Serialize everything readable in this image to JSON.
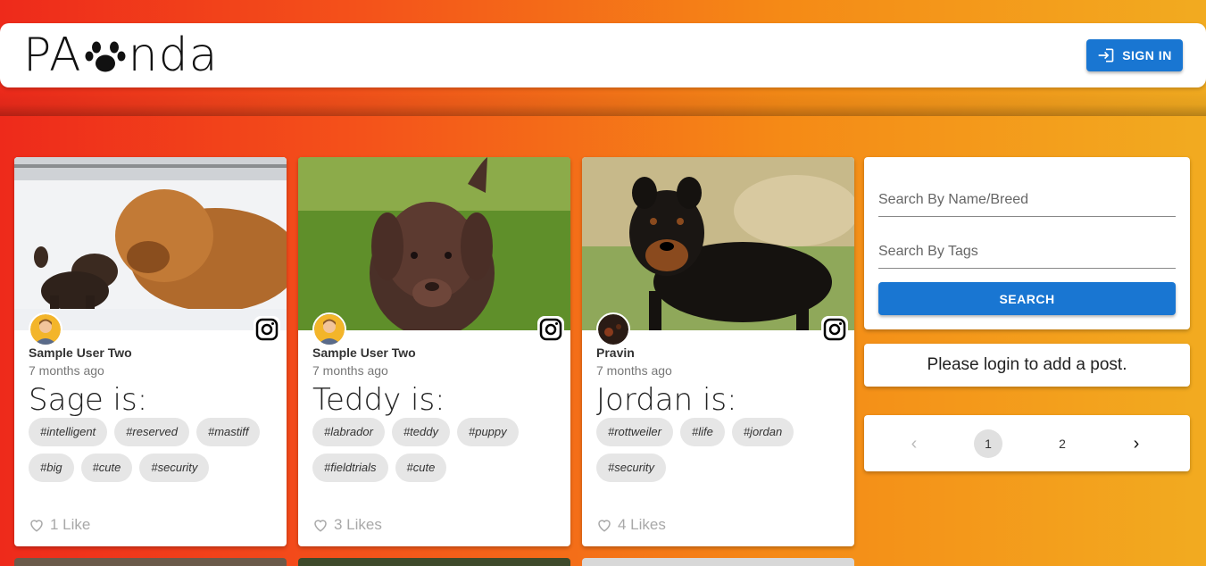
{
  "header": {
    "logo_left": "PA",
    "logo_right": "nda",
    "signin_label": "SIGN IN"
  },
  "posts": [
    {
      "author": "Sample User Two",
      "time": "7 months ago",
      "title": "Sage is:",
      "tags": [
        "#intelligent",
        "#reserved",
        "#mastiff",
        "#big",
        "#cute",
        "#security"
      ],
      "likes": "1 Like"
    },
    {
      "author": "Sample User Two",
      "time": "7 months ago",
      "title": "Teddy is:",
      "tags": [
        "#labrador",
        "#teddy",
        "#puppy",
        "#fieldtrials",
        "#cute"
      ],
      "likes": "3 Likes"
    },
    {
      "author": "Pravin",
      "time": "7 months ago",
      "title": "Jordan is:",
      "tags": [
        "#rottweiler",
        "#life",
        "#jordan",
        "#security"
      ],
      "likes": "4 Likes"
    }
  ],
  "search": {
    "name_placeholder": "Search By Name/Breed",
    "tags_placeholder": "Search By Tags",
    "button_label": "SEARCH"
  },
  "login_message": "Please login to add a post.",
  "pagination": {
    "prev": "‹",
    "pages": [
      "1",
      "2"
    ],
    "current": "1",
    "next": "›"
  },
  "colors": {
    "primary": "#1976d2",
    "gradient_start": "#ee2a1b",
    "gradient_end": "#f2ab20"
  }
}
